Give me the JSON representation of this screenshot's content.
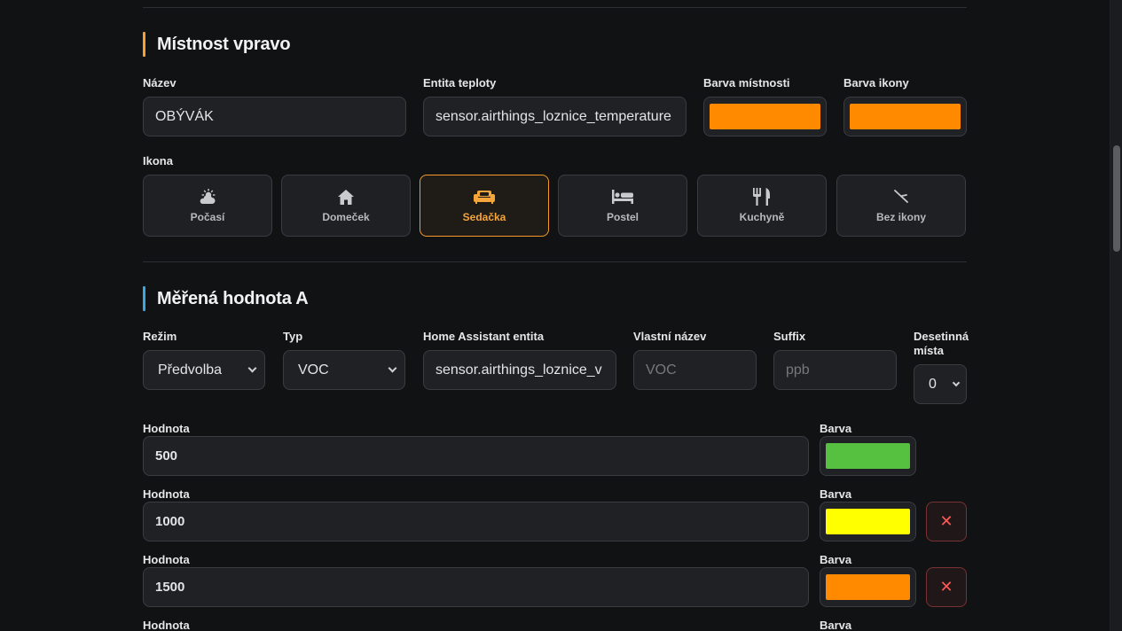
{
  "room_section": {
    "title": "Místnost vpravo",
    "accent": "#f5a030",
    "name_label": "Název",
    "name_value": "OBÝVÁK",
    "temp_entity_label": "Entita teploty",
    "temp_entity_value": "sensor.airthings_loznice_temperature",
    "room_color_label": "Barva místnosti",
    "room_color": "#ff8a00",
    "icon_color_label": "Barva ikony",
    "icon_color": "#ff8a00",
    "icon_label": "Ikona",
    "icons": [
      {
        "label": "Počasí",
        "icon": "weather-icon"
      },
      {
        "label": "Domeček",
        "icon": "home-icon"
      },
      {
        "label": "Sedačka",
        "icon": "sofa-icon",
        "selected": true
      },
      {
        "label": "Postel",
        "icon": "bed-icon"
      },
      {
        "label": "Kuchyně",
        "icon": "fork-knife-icon"
      },
      {
        "label": "Bez ikony",
        "icon": "no-icon"
      }
    ]
  },
  "measure_section": {
    "title": "Měřená hodnota A",
    "accent": "#38a8e0",
    "mode_label": "Režim",
    "mode_value": "Předvolba",
    "type_label": "Typ",
    "type_value": "VOC",
    "entity_label": "Home Assistant entita",
    "entity_value": "sensor.airthings_loznice_v",
    "custom_name_label": "Vlastní název",
    "custom_name_placeholder": "VOC",
    "suffix_label": "Suffix",
    "suffix_placeholder": "ppb",
    "decimals_label_1": "Desetinná",
    "decimals_label_2": "místa",
    "decimals_value": "0",
    "value_label": "Hodnota",
    "color_label": "Barva",
    "thresholds": [
      {
        "value": "500",
        "color": "#56c040",
        "removable": false
      },
      {
        "value": "1000",
        "color": "#ffff00",
        "removable": true
      },
      {
        "value": "1500",
        "color": "#ff8a00",
        "removable": true
      }
    ],
    "delete_symbol": "✕"
  }
}
